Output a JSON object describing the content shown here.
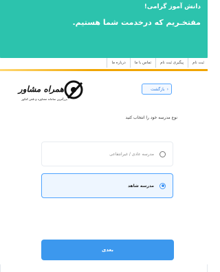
{
  "header": {
    "greeting": "دانش آموز گرامی!",
    "welcome": "مفتخـریم که درخدمت شما هستیم."
  },
  "tabs": [
    {
      "label": "ثبت نام"
    },
    {
      "label": "پیگیری ثبت نام"
    },
    {
      "label": "تماس با ما"
    },
    {
      "label": "درباره ما"
    }
  ],
  "back_label": "بازگشت",
  "logo": {
    "title": "همراه مشاور",
    "subtitle": "بزرگترین سامانه مشاوره و تلفن کنکور"
  },
  "prompt": "نوع مدرسه خود را انتخاب کنید",
  "options": [
    {
      "label": "مدرسه عادی / غیرانتفاعی",
      "selected": false
    },
    {
      "label": "مدرسه شاهد",
      "selected": true
    }
  ],
  "next_label": "بعدی",
  "colors": {
    "header": "#2cc3ad",
    "accent": "#3c98ee",
    "tab_strip": "#f0a500"
  }
}
